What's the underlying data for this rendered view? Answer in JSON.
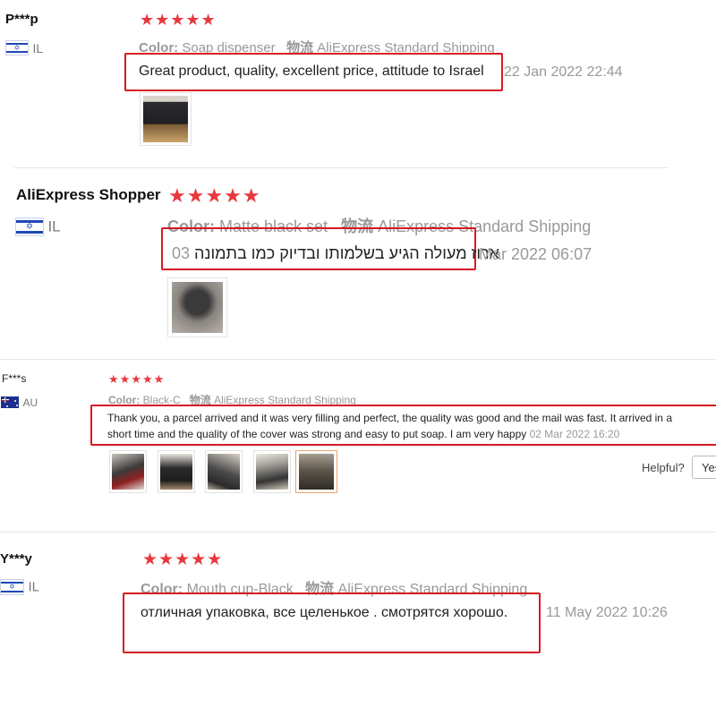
{
  "reviews": [
    {
      "name": "P***p",
      "country": "IL",
      "stars": "★★★★★",
      "color_label": "Color:",
      "color_value": "Soap dispenser",
      "shipping_label": "物流",
      "shipping_value": "AliExpress Standard Shipping",
      "text": "Great product, quality, excellent price, attitude to Israel",
      "date": "22 Jan 2022 22:44"
    },
    {
      "name": "AliExpress Shopper",
      "country": "IL",
      "stars": "★★★★★",
      "color_label": "Color:",
      "color_value": "Matte black set",
      "shipping_label": "物流",
      "shipping_value": "AliExpress Standard Shipping",
      "text": "ארוז מעולה הגיע בשלמותו ובדיוק כמו בתמונה",
      "date_prefix": "03",
      "date": "Mar 2022 06:07"
    },
    {
      "name": "F***s",
      "country": "AU",
      "stars": "★★★★★",
      "color_label": "Color:",
      "color_value": "Black-C",
      "shipping_label": "物流",
      "shipping_value": "AliExpress Standard Shipping",
      "text_line1": "Thank you, a parcel arrived and it was very filling and perfect, the quality was good and the mail was fast. It arrived in a",
      "text_line2": "short time and the quality of the cover was strong and easy to put soap. I am very happy",
      "date": "02 Mar 2022 16:20",
      "helpful_label": "Helpful?",
      "yes_label": "Yes"
    },
    {
      "name": "Y***y",
      "country": "IL",
      "stars": "★★★★★",
      "color_label": "Color:",
      "color_value": "Mouth cup-Black",
      "shipping_label": "物流",
      "shipping_value": "AliExpress Standard Shipping",
      "text": "отличная упаковка, все целенькое . смотрятся хорошо.",
      "date": "11 May 2022 10:26"
    }
  ],
  "colors": {
    "star": "#e8383d",
    "highlight_box": "#d71920",
    "meta_text": "#999999"
  }
}
